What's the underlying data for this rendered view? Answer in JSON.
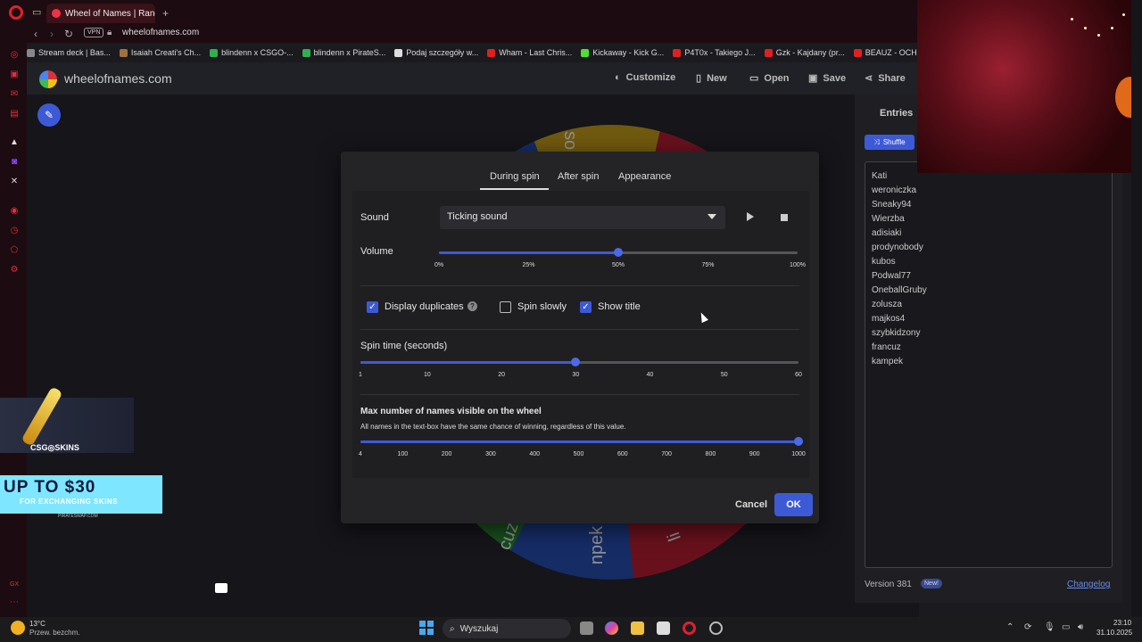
{
  "browser": {
    "tab_title": "Wheel of Names | Random",
    "url": "wheelofnames.com",
    "vpn_label": "VPN",
    "bookmarks": [
      {
        "label": "Stream deck | Bas...",
        "color": "#888888"
      },
      {
        "label": "Isaiah Creati's Ch...",
        "color": "#a07040"
      },
      {
        "label": "blindenn x CSGO-...",
        "color": "#30b050"
      },
      {
        "label": "blindenn x PirateS...",
        "color": "#30b050"
      },
      {
        "label": "Podaj szczegóły w...",
        "color": "#dddddd"
      },
      {
        "label": "Wham - Last Chris...",
        "color": "#e02020"
      },
      {
        "label": "Kickaway - Kick G...",
        "color": "#50e030"
      },
      {
        "label": "P4T0x - Takiego J...",
        "color": "#e02020"
      },
      {
        "label": "Gzk - Kajdany (pr...",
        "color": "#e02020"
      },
      {
        "label": "BEAUZ - OCH...",
        "color": "#e02020"
      }
    ]
  },
  "site": {
    "name": "wheelofnames.com",
    "header_buttons": {
      "customize": "Customize",
      "new": "New",
      "open": "Open",
      "save": "Save",
      "share": "Share"
    }
  },
  "wheel_labels": {
    "top": "so",
    "bottom_left": "cuz",
    "bottom_mid": "npek",
    "bottom_right": "li"
  },
  "entries_panel": {
    "tab_label": "Entries",
    "shuffle_label": "Shuffle",
    "entries": [
      "Kati",
      "weroniczka",
      "Sneaky94",
      "Wierzba",
      "adisiaki",
      "prodynobody",
      "kubos",
      "Podwal77",
      "OneballGruby",
      "zolusza",
      "majkos4",
      "szybkidzony",
      "francuz",
      "kampek"
    ],
    "version": "Version 381",
    "new_badge": "New!",
    "changelog": "Changelog"
  },
  "ad": {
    "logo": "CSG◎SKINS",
    "headline": "UP TO $30",
    "subline": "FOR EXCHANGING SKINS",
    "site": "PIRATESWAP.COM"
  },
  "modal": {
    "tabs": [
      "During spin",
      "After spin",
      "Appearance"
    ],
    "active_tab": "During spin",
    "sound": {
      "label": "Sound",
      "selected": "Ticking sound"
    },
    "volume": {
      "label": "Volume",
      "value_percent": 50,
      "ticks": [
        "0%",
        "25%",
        "50%",
        "75%",
        "100%"
      ]
    },
    "checkboxes": {
      "display_duplicates": {
        "label": "Display duplicates",
        "checked": true
      },
      "spin_slowly": {
        "label": "Spin slowly",
        "checked": false
      },
      "show_title": {
        "label": "Show title",
        "checked": true
      }
    },
    "spin_time": {
      "label": "Spin time (seconds)",
      "min": 1,
      "max": 60,
      "value": 30,
      "ticks": [
        "1",
        "10",
        "20",
        "30",
        "40",
        "50",
        "60"
      ]
    },
    "max_names": {
      "label": "Max number of names visible on the wheel",
      "description": "All names in the text-box have the same chance of winning, regardless of this value.",
      "min": 4,
      "max": 1000,
      "value": 1000,
      "ticks": [
        "4",
        "100",
        "200",
        "300",
        "400",
        "500",
        "600",
        "700",
        "800",
        "900",
        "1000"
      ]
    },
    "cancel_label": "Cancel",
    "ok_label": "OK"
  },
  "taskbar": {
    "weather_temp": "13°C",
    "weather_desc": "Przew. bezchm.",
    "search_placeholder": "Wyszukaj",
    "time": "23:10",
    "date": "31.10.2025"
  },
  "colors": {
    "accent": "#3d5ad6",
    "opera_red": "#e0202e"
  }
}
